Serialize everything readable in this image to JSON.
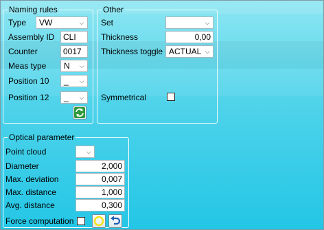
{
  "naming_rules": {
    "legend": "Naming rules",
    "type": {
      "label": "Type",
      "value": "VW"
    },
    "assembly_id": {
      "label": "Assembly ID",
      "value": "CLI"
    },
    "counter": {
      "label": "Counter",
      "value": "0017"
    },
    "meas_type": {
      "label": "Meas type",
      "value": "N"
    },
    "position_10": {
      "label": "Position 10",
      "value": "_"
    },
    "position_12": {
      "label": "Position 12",
      "value": "_"
    },
    "refresh_icon": "refresh-icon"
  },
  "other": {
    "legend": "Other",
    "set": {
      "label": "Set",
      "value": ""
    },
    "thickness": {
      "label": "Thickness",
      "value": "0,00"
    },
    "thickness_toggle": {
      "label": "Thickness toggle",
      "value": "ACTUAL"
    },
    "symmetrical": {
      "label": "Symmetrical",
      "checked": false
    }
  },
  "optical": {
    "legend": "Optical parameter",
    "point_cloud": {
      "label": "Point cloud",
      "value": ""
    },
    "diameter": {
      "label": "Diameter",
      "value": "2,000"
    },
    "max_deviation": {
      "label": "Max. deviation",
      "value": "0,007"
    },
    "max_distance": {
      "label": "Max. distance",
      "value": "1,000"
    },
    "avg_distance": {
      "label": "Avg. distance",
      "value": "0,300"
    },
    "force_computation": {
      "label": "Force computation",
      "checked": false
    },
    "circle_icon": "yellow-circle-icon",
    "undo_icon": "undo-icon"
  },
  "colors": {
    "accent": "#2fc9e8",
    "refresh_green": "#2e9a3a",
    "circle_yellow": "#f2e21b",
    "undo_blue": "#1f5fb4"
  }
}
